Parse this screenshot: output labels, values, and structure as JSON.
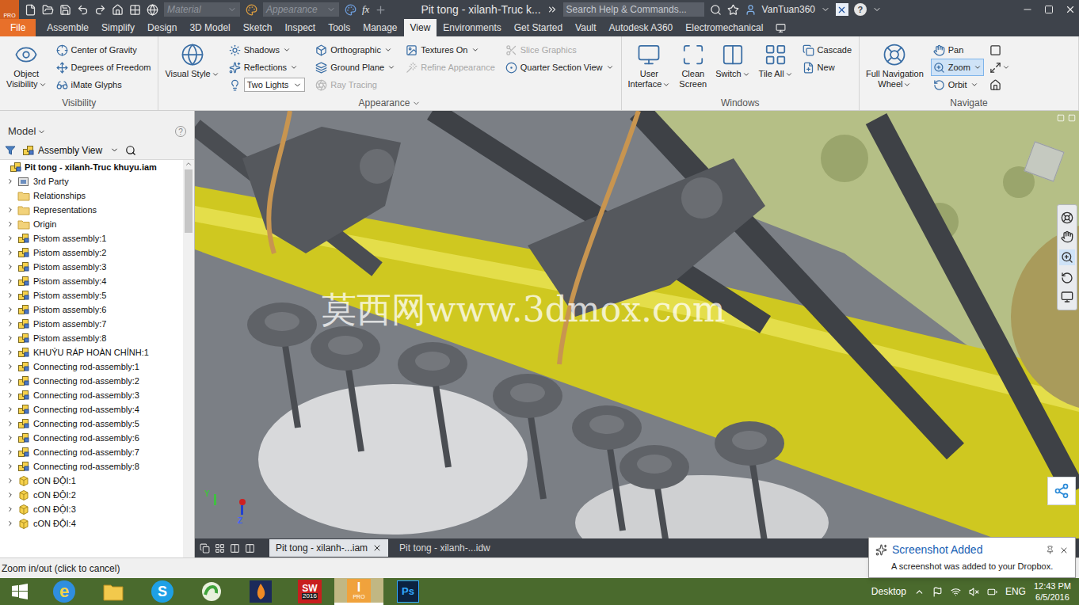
{
  "title_bar": {
    "badge": "PRO",
    "material": "Material",
    "appearance": "Appearance",
    "fx": "fx",
    "title": "Pit tong - xilanh-Truc k...",
    "search_placeholder": "Search Help & Commands...",
    "user": "VanTuan360",
    "help": "?"
  },
  "ribbon_tabs": [
    {
      "label": "File",
      "selected": false,
      "kind": "file"
    },
    {
      "label": "Assemble",
      "selected": false,
      "kind": "tab"
    },
    {
      "label": "Simplify",
      "selected": false,
      "kind": "tab"
    },
    {
      "label": "Design",
      "selected": false,
      "kind": "tab"
    },
    {
      "label": "3D Model",
      "selected": false,
      "kind": "tab"
    },
    {
      "label": "Sketch",
      "selected": false,
      "kind": "tab"
    },
    {
      "label": "Inspect",
      "selected": false,
      "kind": "tab"
    },
    {
      "label": "Tools",
      "selected": false,
      "kind": "tab"
    },
    {
      "label": "Manage",
      "selected": false,
      "kind": "tab"
    },
    {
      "label": "View",
      "selected": true,
      "kind": "tab"
    },
    {
      "label": "Environments",
      "selected": false,
      "kind": "tab"
    },
    {
      "label": "Get Started",
      "selected": false,
      "kind": "tab"
    },
    {
      "label": "Vault",
      "selected": false,
      "kind": "tab"
    },
    {
      "label": "Autodesk A360",
      "selected": false,
      "kind": "tab"
    },
    {
      "label": "Electromechanical",
      "selected": false,
      "kind": "tab"
    }
  ],
  "ribbon_groups": [
    {
      "label": "Visibility",
      "dropdown": false,
      "columns": [
        {
          "kind": "large",
          "lines": [
            "Object",
            "Visibility"
          ],
          "dropdown": true,
          "disabled": false
        },
        {
          "kind": "stack",
          "items": [
            {
              "label": "Center of Gravity",
              "dropdown": false,
              "disabled": false,
              "selected": false,
              "combo": false
            },
            {
              "label": "Degrees of Freedom",
              "dropdown": false,
              "disabled": false,
              "selected": false,
              "combo": false
            },
            {
              "label": "iMate Glyphs",
              "dropdown": false,
              "disabled": false,
              "selected": false,
              "combo": false
            }
          ]
        }
      ]
    },
    {
      "label": "Appearance",
      "dropdown": true,
      "columns": [
        {
          "kind": "large",
          "lines": [
            "Visual Style"
          ],
          "dropdown": true,
          "disabled": false
        },
        {
          "kind": "stack",
          "items": [
            {
              "label": "Shadows",
              "dropdown": true,
              "disabled": false,
              "selected": false,
              "combo": false
            },
            {
              "label": "Reflections",
              "dropdown": true,
              "disabled": false,
              "selected": false,
              "combo": false
            },
            {
              "label": "Two Lights",
              "dropdown": true,
              "disabled": false,
              "selected": false,
              "combo": true
            }
          ]
        },
        {
          "kind": "stack",
          "items": [
            {
              "label": "Orthographic",
              "dropdown": true,
              "disabled": false,
              "selected": false,
              "combo": false
            },
            {
              "label": "Ground Plane",
              "dropdown": true,
              "disabled": false,
              "selected": false,
              "combo": false
            },
            {
              "label": "Ray Tracing",
              "dropdown": false,
              "disabled": true,
              "selected": false,
              "combo": false
            }
          ]
        },
        {
          "kind": "stack",
          "items": [
            {
              "label": "Textures On",
              "dropdown": true,
              "disabled": false,
              "selected": false,
              "combo": false
            },
            {
              "label": "Refine Appearance",
              "dropdown": false,
              "disabled": true,
              "selected": false,
              "combo": false
            }
          ]
        },
        {
          "kind": "stack",
          "items": [
            {
              "label": "Slice Graphics",
              "dropdown": false,
              "disabled": true,
              "selected": false,
              "combo": false
            },
            {
              "label": "Quarter Section View",
              "dropdown": true,
              "disabled": false,
              "selected": false,
              "combo": false
            }
          ]
        }
      ]
    },
    {
      "label": "Windows",
      "dropdown": false,
      "columns": [
        {
          "kind": "large",
          "lines": [
            "User",
            "Interface"
          ],
          "dropdown": true,
          "disabled": false
        },
        {
          "kind": "large",
          "lines": [
            "Clean",
            "Screen"
          ],
          "dropdown": false,
          "disabled": false
        },
        {
          "kind": "large",
          "lines": [
            "Switch"
          ],
          "dropdown": true,
          "disabled": false
        },
        {
          "kind": "large",
          "lines": [
            "Tile All"
          ],
          "dropdown": true,
          "disabled": false
        },
        {
          "kind": "stack",
          "items": [
            {
              "label": "Cascade",
              "dropdown": false,
              "disabled": false,
              "selected": false,
              "combo": false
            },
            {
              "label": "New",
              "dropdown": false,
              "disabled": false,
              "selected": false,
              "combo": false
            }
          ]
        }
      ]
    },
    {
      "label": "Navigate",
      "dropdown": false,
      "columns": [
        {
          "kind": "large",
          "lines": [
            "Full Navigation",
            "Wheel"
          ],
          "dropdown": true,
          "disabled": false
        },
        {
          "kind": "stack",
          "items": [
            {
              "label": "Pan",
              "dropdown": false,
              "disabled": false,
              "selected": false,
              "combo": false
            },
            {
              "label": "Zoom",
              "dropdown": true,
              "disabled": false,
              "selected": true,
              "combo": false
            },
            {
              "label": "Orbit",
              "dropdown": true,
              "disabled": false,
              "selected": false,
              "combo": false
            }
          ]
        },
        {
          "kind": "icon_stack",
          "items": [
            {
              "dropdown": false
            },
            {
              "dropdown": true
            },
            {
              "dropdown": false
            }
          ]
        }
      ]
    }
  ],
  "model_browser": {
    "title": "Model",
    "help": "?",
    "view": "Assembly View",
    "root": "Pit tong - xilanh-Truc khuyu.iam",
    "items": [
      {
        "label": "3rd Party",
        "kind": "thirdparty",
        "expandable": true
      },
      {
        "label": "Relationships",
        "kind": "folder",
        "expandable": false
      },
      {
        "label": "Representations",
        "kind": "folder",
        "expandable": true
      },
      {
        "label": "Origin",
        "kind": "folder",
        "expandable": true
      },
      {
        "label": "Pistom assembly:1",
        "kind": "assembly",
        "expandable": true
      },
      {
        "label": "Pistom assembly:2",
        "kind": "assembly",
        "expandable": true
      },
      {
        "label": "Pistom assembly:3",
        "kind": "assembly",
        "expandable": true
      },
      {
        "label": "Pistom assembly:4",
        "kind": "assembly",
        "expandable": true
      },
      {
        "label": "Pistom assembly:5",
        "kind": "assembly",
        "expandable": true
      },
      {
        "label": "Pistom assembly:6",
        "kind": "assembly",
        "expandable": true
      },
      {
        "label": "Pistom assembly:7",
        "kind": "assembly",
        "expandable": true
      },
      {
        "label": "Pistom assembly:8",
        "kind": "assembly",
        "expandable": true
      },
      {
        "label": "KHUỶU RÁP HOÀN CHỈNH:1",
        "kind": "assembly",
        "expandable": true
      },
      {
        "label": "Connecting rod-assembly:1",
        "kind": "assembly",
        "expandable": true
      },
      {
        "label": "Connecting rod-assembly:2",
        "kind": "assembly",
        "expandable": true
      },
      {
        "label": "Connecting rod-assembly:3",
        "kind": "assembly",
        "expandable": true
      },
      {
        "label": "Connecting rod-assembly:4",
        "kind": "assembly",
        "expandable": true
      },
      {
        "label": "Connecting rod-assembly:5",
        "kind": "assembly",
        "expandable": true
      },
      {
        "label": "Connecting rod-assembly:6",
        "kind": "assembly",
        "expandable": true
      },
      {
        "label": "Connecting rod-assembly:7",
        "kind": "assembly",
        "expandable": true
      },
      {
        "label": "Connecting rod-assembly:8",
        "kind": "assembly",
        "expandable": true
      },
      {
        "label": "cON ĐỘI:1",
        "kind": "part",
        "expandable": true
      },
      {
        "label": "cON ĐỘI:2",
        "kind": "part",
        "expandable": true
      },
      {
        "label": "cON ĐỘI:3",
        "kind": "part",
        "expandable": true
      },
      {
        "label": "cON ĐỘI:4",
        "kind": "part",
        "expandable": true
      }
    ]
  },
  "viewport": {
    "watermark": "莫西网www.3dmox.com",
    "triad": {
      "y": "Y",
      "z": "Z"
    }
  },
  "document_tabs": [
    {
      "label": "Pit tong - xilanh-...iam",
      "selected": true,
      "closable": true
    },
    {
      "label": "Pit tong - xilanh-...idw",
      "selected": false,
      "closable": false
    }
  ],
  "status_bar": {
    "text": "Zoom in/out (click to cancel)"
  },
  "taskbar": {
    "apps": [
      {
        "kind": "ie",
        "text": "e",
        "sub": "",
        "selected": false
      },
      {
        "kind": "explorer",
        "text": "",
        "sub": "",
        "selected": false
      },
      {
        "kind": "skype",
        "text": "S",
        "sub": "",
        "selected": false
      },
      {
        "kind": "green",
        "text": "",
        "sub": "",
        "selected": false
      },
      {
        "kind": "flame",
        "text": "",
        "sub": "",
        "selected": false
      },
      {
        "kind": "sw",
        "text": "SW",
        "sub": "2016",
        "selected": false
      },
      {
        "kind": "inventor",
        "text": "I",
        "sub": "PRO",
        "selected": true
      },
      {
        "kind": "ps",
        "text": "Ps",
        "sub": "",
        "selected": false
      }
    ],
    "desktop": "Desktop",
    "lang": "ENG",
    "time": "12:43 PM",
    "date": "6/5/2016"
  },
  "notification": {
    "title": "Screenshot Added",
    "body": "A screenshot was added to your Dropbox."
  }
}
